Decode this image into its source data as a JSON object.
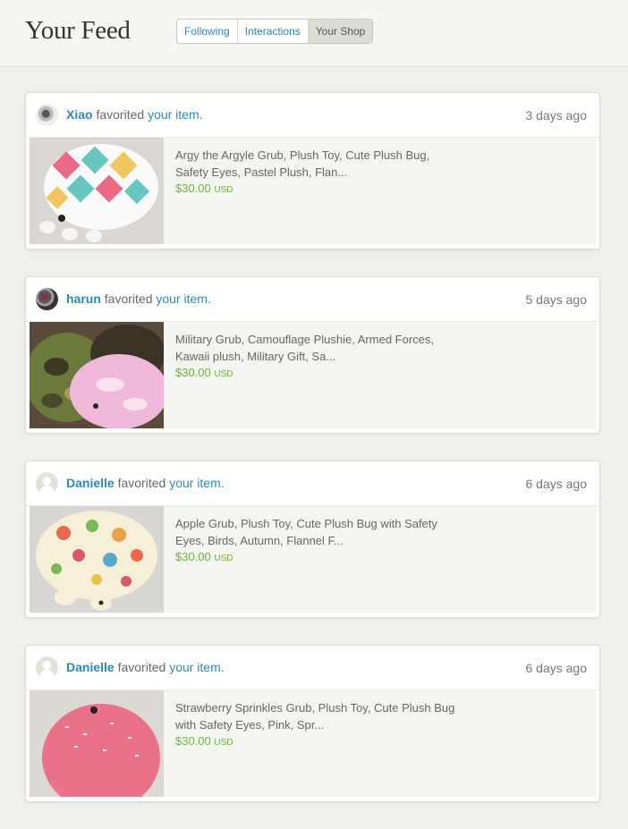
{
  "header": {
    "title": "Your Feed",
    "tabs": [
      {
        "label": "Following"
      },
      {
        "label": "Interactions"
      },
      {
        "label": "Your Shop"
      }
    ]
  },
  "feed": [
    {
      "user": "Xiao",
      "action": "favorited",
      "link": "your item.",
      "time": "3 days ago",
      "item": "Argy the Argyle Grub, Plush Toy, Cute Plush Bug, Safety Eyes, Pastel Plush, Flan...",
      "price": "$30.00",
      "currency": "USD"
    },
    {
      "user": "harun",
      "action": "favorited",
      "link": "your item.",
      "time": "5 days ago",
      "item": "Military Grub, Camouflage Plushie, Armed Forces, Kawaii plush, Military Gift, Sa...",
      "price": "$30.00",
      "currency": "USD"
    },
    {
      "user": "Danielle",
      "action": "favorited",
      "link": "your item.",
      "time": "6 days ago",
      "item": "Apple Grub, Plush Toy, Cute Plush Bug with Safety Eyes, Birds, Autumn, Flannel F...",
      "price": "$30.00",
      "currency": "USD"
    },
    {
      "user": "Danielle",
      "action": "favorited",
      "link": "your item.",
      "time": "6 days ago",
      "item": "Strawberry Sprinkles Grub, Plush Toy, Cute Plush Bug with Safety Eyes, Pink, Spr...",
      "price": "$30.00",
      "currency": "USD"
    }
  ]
}
